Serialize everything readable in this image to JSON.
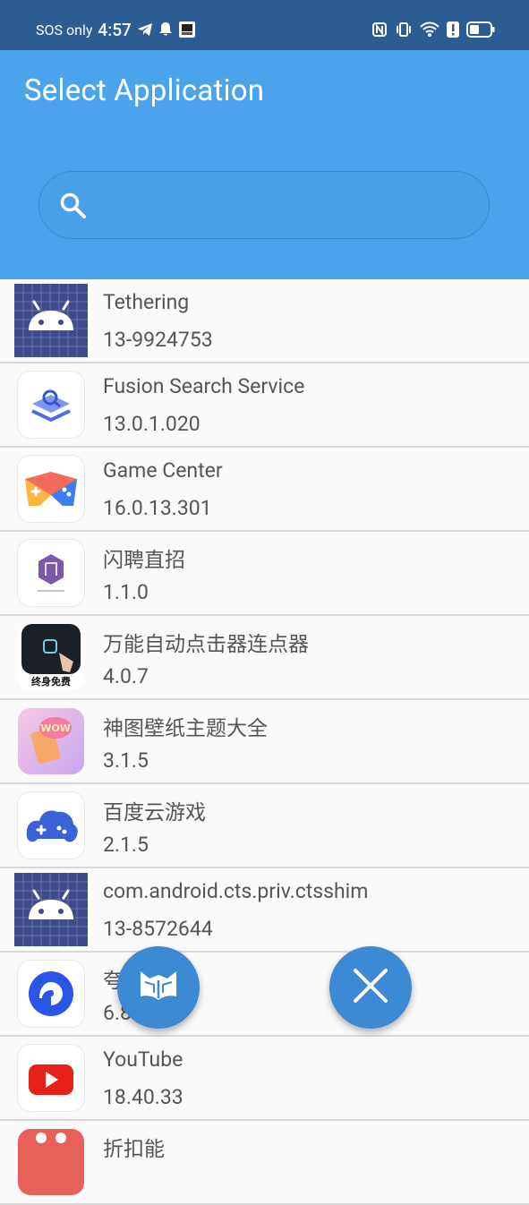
{
  "status_bar": {
    "sos_text": "SOS only",
    "time": "4:57"
  },
  "app_bar": {
    "title": "Select Application",
    "search": {
      "placeholder": ""
    }
  },
  "apps": [
    {
      "name": "Tethering",
      "version": "13-9924753",
      "icon": "android-icon"
    },
    {
      "name": "Fusion Search Service",
      "version": "13.0.1.020",
      "icon": "fusion-search-icon"
    },
    {
      "name": "Game Center",
      "version": "16.0.13.301",
      "icon": "game-center-icon"
    },
    {
      "name": "闪聘直招",
      "version": "1.1.0",
      "icon": "shanpin-icon"
    },
    {
      "name": "万能自动点击器连点器",
      "version": "4.0.7",
      "icon": "auto-clicker-icon",
      "badge": "终身免费"
    },
    {
      "name": "神图壁纸主题大全",
      "version": "3.1.5",
      "icon": "wallpaper-icon"
    },
    {
      "name": "百度云游戏",
      "version": "2.1.5",
      "icon": "baidu-cloud-game-icon"
    },
    {
      "name": "com.android.cts.priv.ctsshim",
      "version": "13-8572644",
      "icon": "android-icon"
    },
    {
      "name": "夸",
      "version": "6.8",
      "icon": "quark-icon"
    },
    {
      "name": "YouTube",
      "version": "18.40.33",
      "icon": "youtube-icon"
    },
    {
      "name": "折扣能",
      "version": "",
      "icon": "zhekou-icon"
    }
  ],
  "fabs": {
    "left": "fox-book-icon",
    "right": "close-icon"
  },
  "colors": {
    "status_bar": "#2d5c95",
    "app_bar": "#4ba3eb",
    "fab": "#3c8ad3",
    "text": "#555555"
  }
}
